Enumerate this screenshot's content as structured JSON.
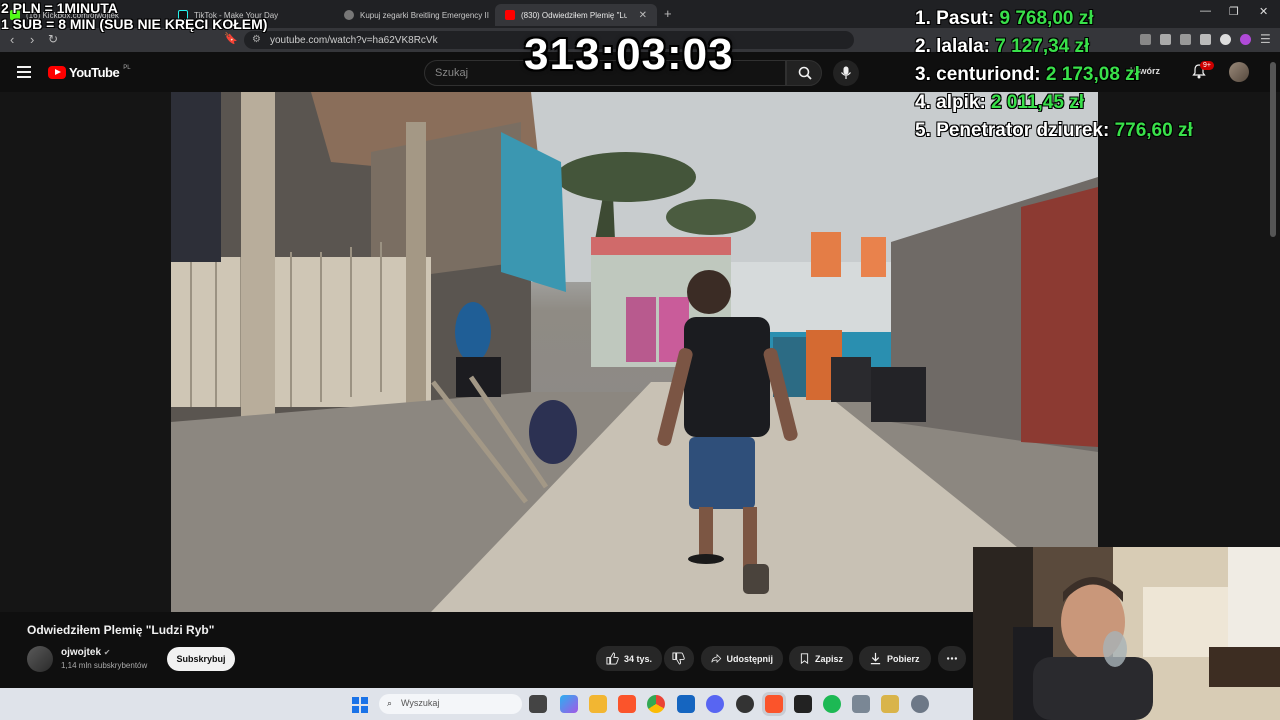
{
  "browser": {
    "tabs": [
      {
        "label": "(16) Kickbox.com/ojwojtek",
        "favicon": "kick"
      },
      {
        "label": "TikTok - Make Your Day",
        "favicon": "tiktok"
      },
      {
        "label": "Kupuj zegarki Breitling Emergency II",
        "favicon": "breitling"
      },
      {
        "label": "(830) Odwiedziłem Plemię \"Lu",
        "favicon": "youtube",
        "active": true
      }
    ],
    "url": "youtube.com/watch?v=ha62VK8RcVk"
  },
  "youtube": {
    "logo_text": "YouTube",
    "region": "PL",
    "search_placeholder": "Szukaj",
    "create_label": "Utwórz",
    "notifications_badge": "9+",
    "video": {
      "title": "Odwiedziłem Plemię \"Ludzi Ryb\"",
      "channel": "ojwojtek",
      "verified_mark": "✔",
      "subscribers": "1,14 mln subskrybentów",
      "subscribe_label": "Subskrybuj",
      "likes": "34 tys.",
      "share_label": "Udostępnij",
      "save_label": "Zapisz",
      "download_label": "Pobierz"
    }
  },
  "stream_overlay": {
    "rate_line_1": "2 PLN = 1MINUTA",
    "rate_line_2": "1 SUB = 8 MIN (SUB NIE KRĘCI KOŁEM)",
    "timer": "313:03:03",
    "leaderboard": [
      {
        "rank": "1.",
        "name": "Pasut:",
        "amount": "9 768,00 zł"
      },
      {
        "rank": "2.",
        "name": "lalala:",
        "amount": "7 127,34 zł"
      },
      {
        "rank": "3.",
        "name": "centuriond:",
        "amount": "2 173,08 zł"
      },
      {
        "rank": "4.",
        "name": "alpik:",
        "amount": "2 011,45 zł"
      },
      {
        "rank": "5.",
        "name": "Penetrator dziurek:",
        "amount": "776,60 zł"
      }
    ]
  },
  "taskbar": {
    "search_placeholder": "Wyszukaj"
  },
  "colors": {
    "yt_red": "#ff0000",
    "donation_green": "#39e04a",
    "background": "#0f0f0f"
  }
}
